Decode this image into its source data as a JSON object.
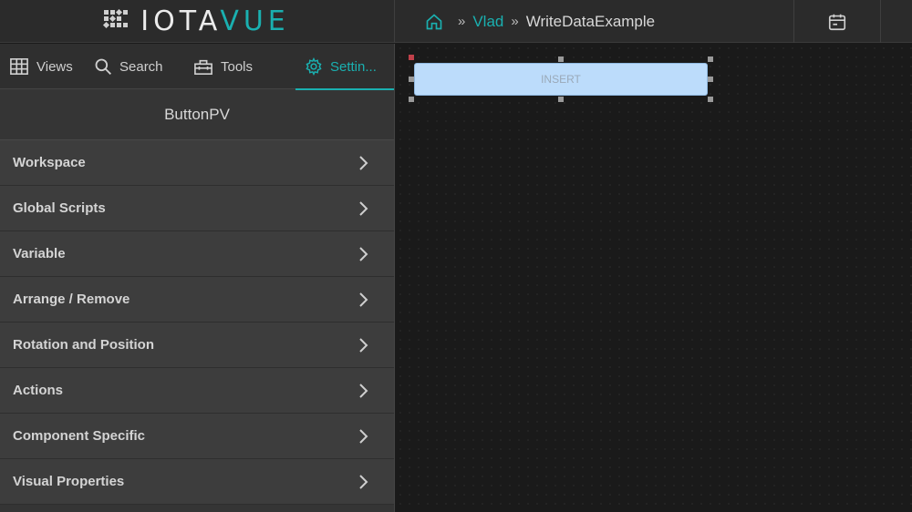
{
  "header": {
    "logo_white": "IOTA",
    "logo_teal": "VUE",
    "breadcrumb": {
      "home_icon": "home-icon",
      "separator": "»",
      "parent": "Vlad",
      "current": "WriteDataExample"
    },
    "calendar_icon": "calendar-icon"
  },
  "sidebar": {
    "tabs": [
      {
        "label": "Views",
        "icon": "grid-icon"
      },
      {
        "label": "Search",
        "icon": "search-icon"
      },
      {
        "label": "Tools",
        "icon": "toolbox-icon"
      },
      {
        "label": "Settin...",
        "icon": "gear-icon"
      }
    ],
    "panel_title": "ButtonPV",
    "items": [
      {
        "label": "Workspace"
      },
      {
        "label": "Global Scripts"
      },
      {
        "label": "Variable"
      },
      {
        "label": "Arrange / Remove"
      },
      {
        "label": "Rotation and Position"
      },
      {
        "label": "Actions"
      },
      {
        "label": "Component Specific"
      },
      {
        "label": "Visual Properties"
      }
    ]
  },
  "canvas": {
    "button_label": "INSERT"
  },
  "colors": {
    "accent": "#1ab0b0",
    "button_bg": "#bcdcfb",
    "panel_bg": "#353535"
  }
}
